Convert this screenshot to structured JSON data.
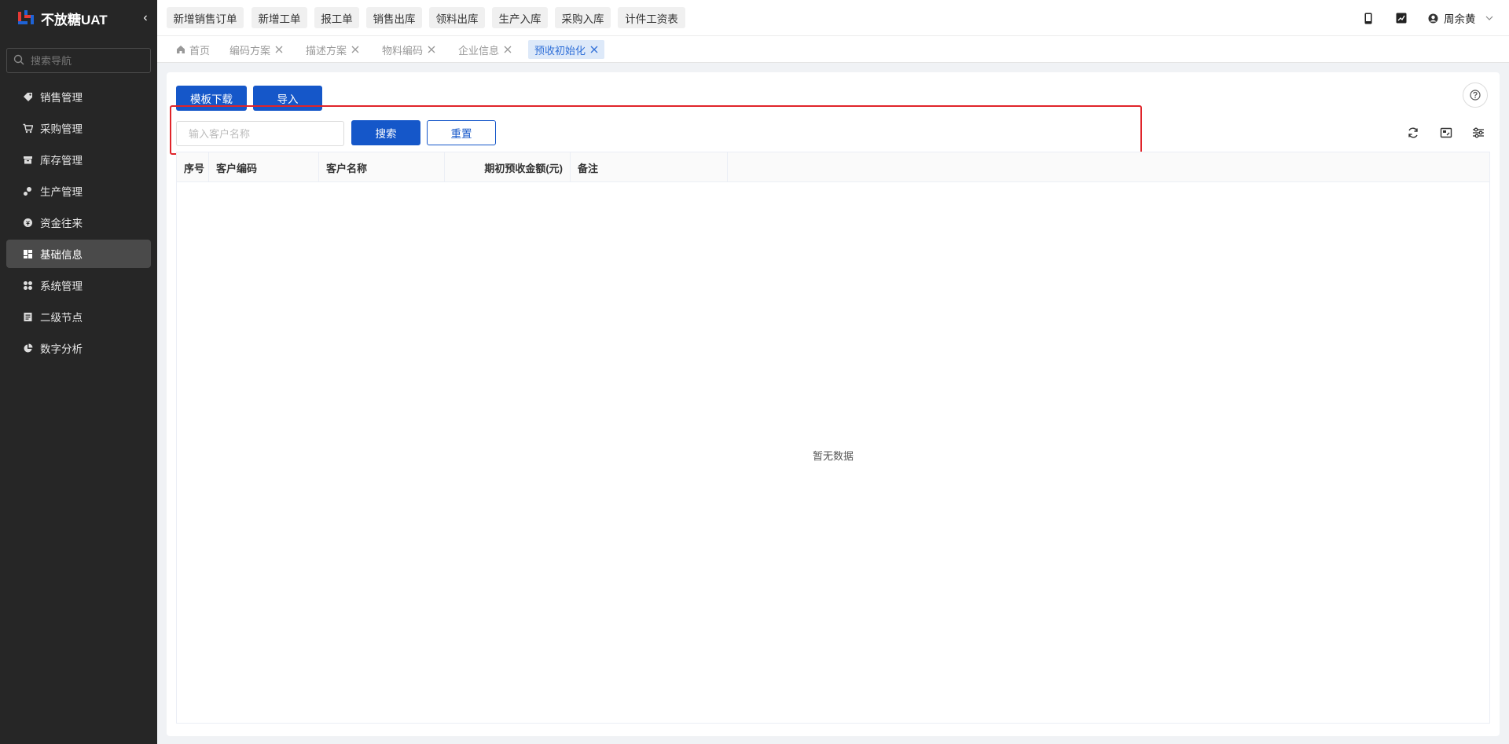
{
  "app": {
    "title": "不放糖UAT",
    "collapse_glyph": "‹",
    "search_placeholder": "搜索导航"
  },
  "sidebar": {
    "items": [
      {
        "label": "销售管理",
        "icon": "tag-icon"
      },
      {
        "label": "采购管理",
        "icon": "cart-icon"
      },
      {
        "label": "库存管理",
        "icon": "box-icon"
      },
      {
        "label": "生产管理",
        "icon": "production-icon"
      },
      {
        "label": "资金往来",
        "icon": "fund-icon"
      },
      {
        "label": "基础信息",
        "icon": "dashboard-icon",
        "active": true
      },
      {
        "label": "系统管理",
        "icon": "grid-icon"
      },
      {
        "label": "二级节点",
        "icon": "document-icon"
      },
      {
        "label": "数字分析",
        "icon": "pie-chart-icon"
      }
    ]
  },
  "quick_actions": [
    "新增销售订单",
    "新增工单",
    "报工单",
    "销售出库",
    "领料出库",
    "生产入库",
    "采购入库",
    "计件工资表"
  ],
  "user": {
    "name": "周余黄"
  },
  "tabs": [
    {
      "label": "首页",
      "home": true
    },
    {
      "label": "编码方案",
      "closable": true
    },
    {
      "label": "描述方案",
      "closable": true
    },
    {
      "label": "物料编码",
      "closable": true
    },
    {
      "label": "企业信息",
      "closable": true
    },
    {
      "label": "预收初始化",
      "closable": true,
      "active": true
    }
  ],
  "toolbar": {
    "template_download": "模板下载",
    "import": "导入"
  },
  "filter": {
    "customer_placeholder": "输入客户名称",
    "customer_value": "",
    "search_label": "搜索",
    "reset_label": "重置"
  },
  "table": {
    "columns": [
      "序号",
      "客户编码",
      "客户名称",
      "期初预收金额(元)",
      "备注"
    ],
    "rows": [],
    "empty_text": "暂无数据"
  },
  "colors": {
    "sidebar_bg": "#262626",
    "primary": "#1557c9",
    "highlight": "#e0242a",
    "active_tab_bg": "#dde9f9"
  }
}
